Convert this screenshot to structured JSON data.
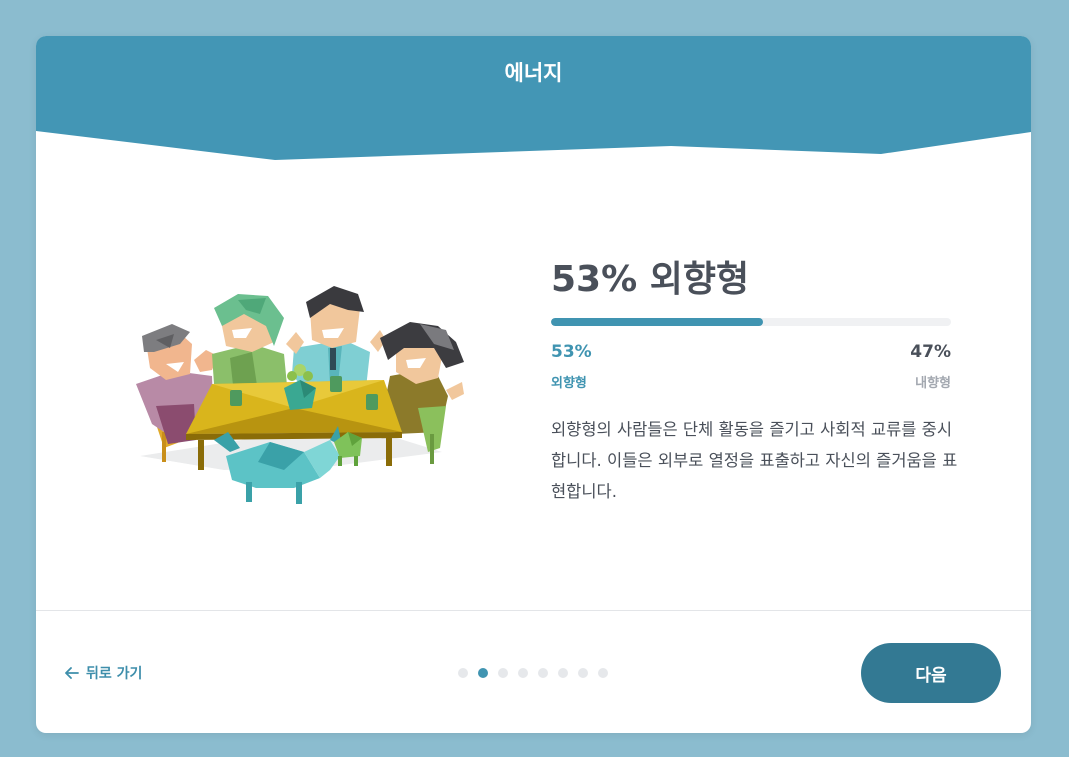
{
  "header": {
    "title": "에너지",
    "color": "#4396b5"
  },
  "result": {
    "title": "53% 외향형",
    "progress_percent": 53,
    "left_percent": "53%",
    "left_label": "외향형",
    "right_percent": "47%",
    "right_label": "내향형",
    "accent_color": "#4094b1",
    "description": "외향형의 사람들은 단체 활동을 즐기고 사회적 교류를 중시합니다. 이들은 외부로 열정을 표출하고 자신의 즐거움을 표현합니다."
  },
  "footer": {
    "back_label": "뒤로 가기",
    "back_icon": "arrow-left-icon",
    "next_label": "다음",
    "next_color": "#337993",
    "pagination": {
      "total": 8,
      "current": 2
    }
  },
  "illustration": {
    "subject": "group-of-people-at-table-illustration"
  }
}
